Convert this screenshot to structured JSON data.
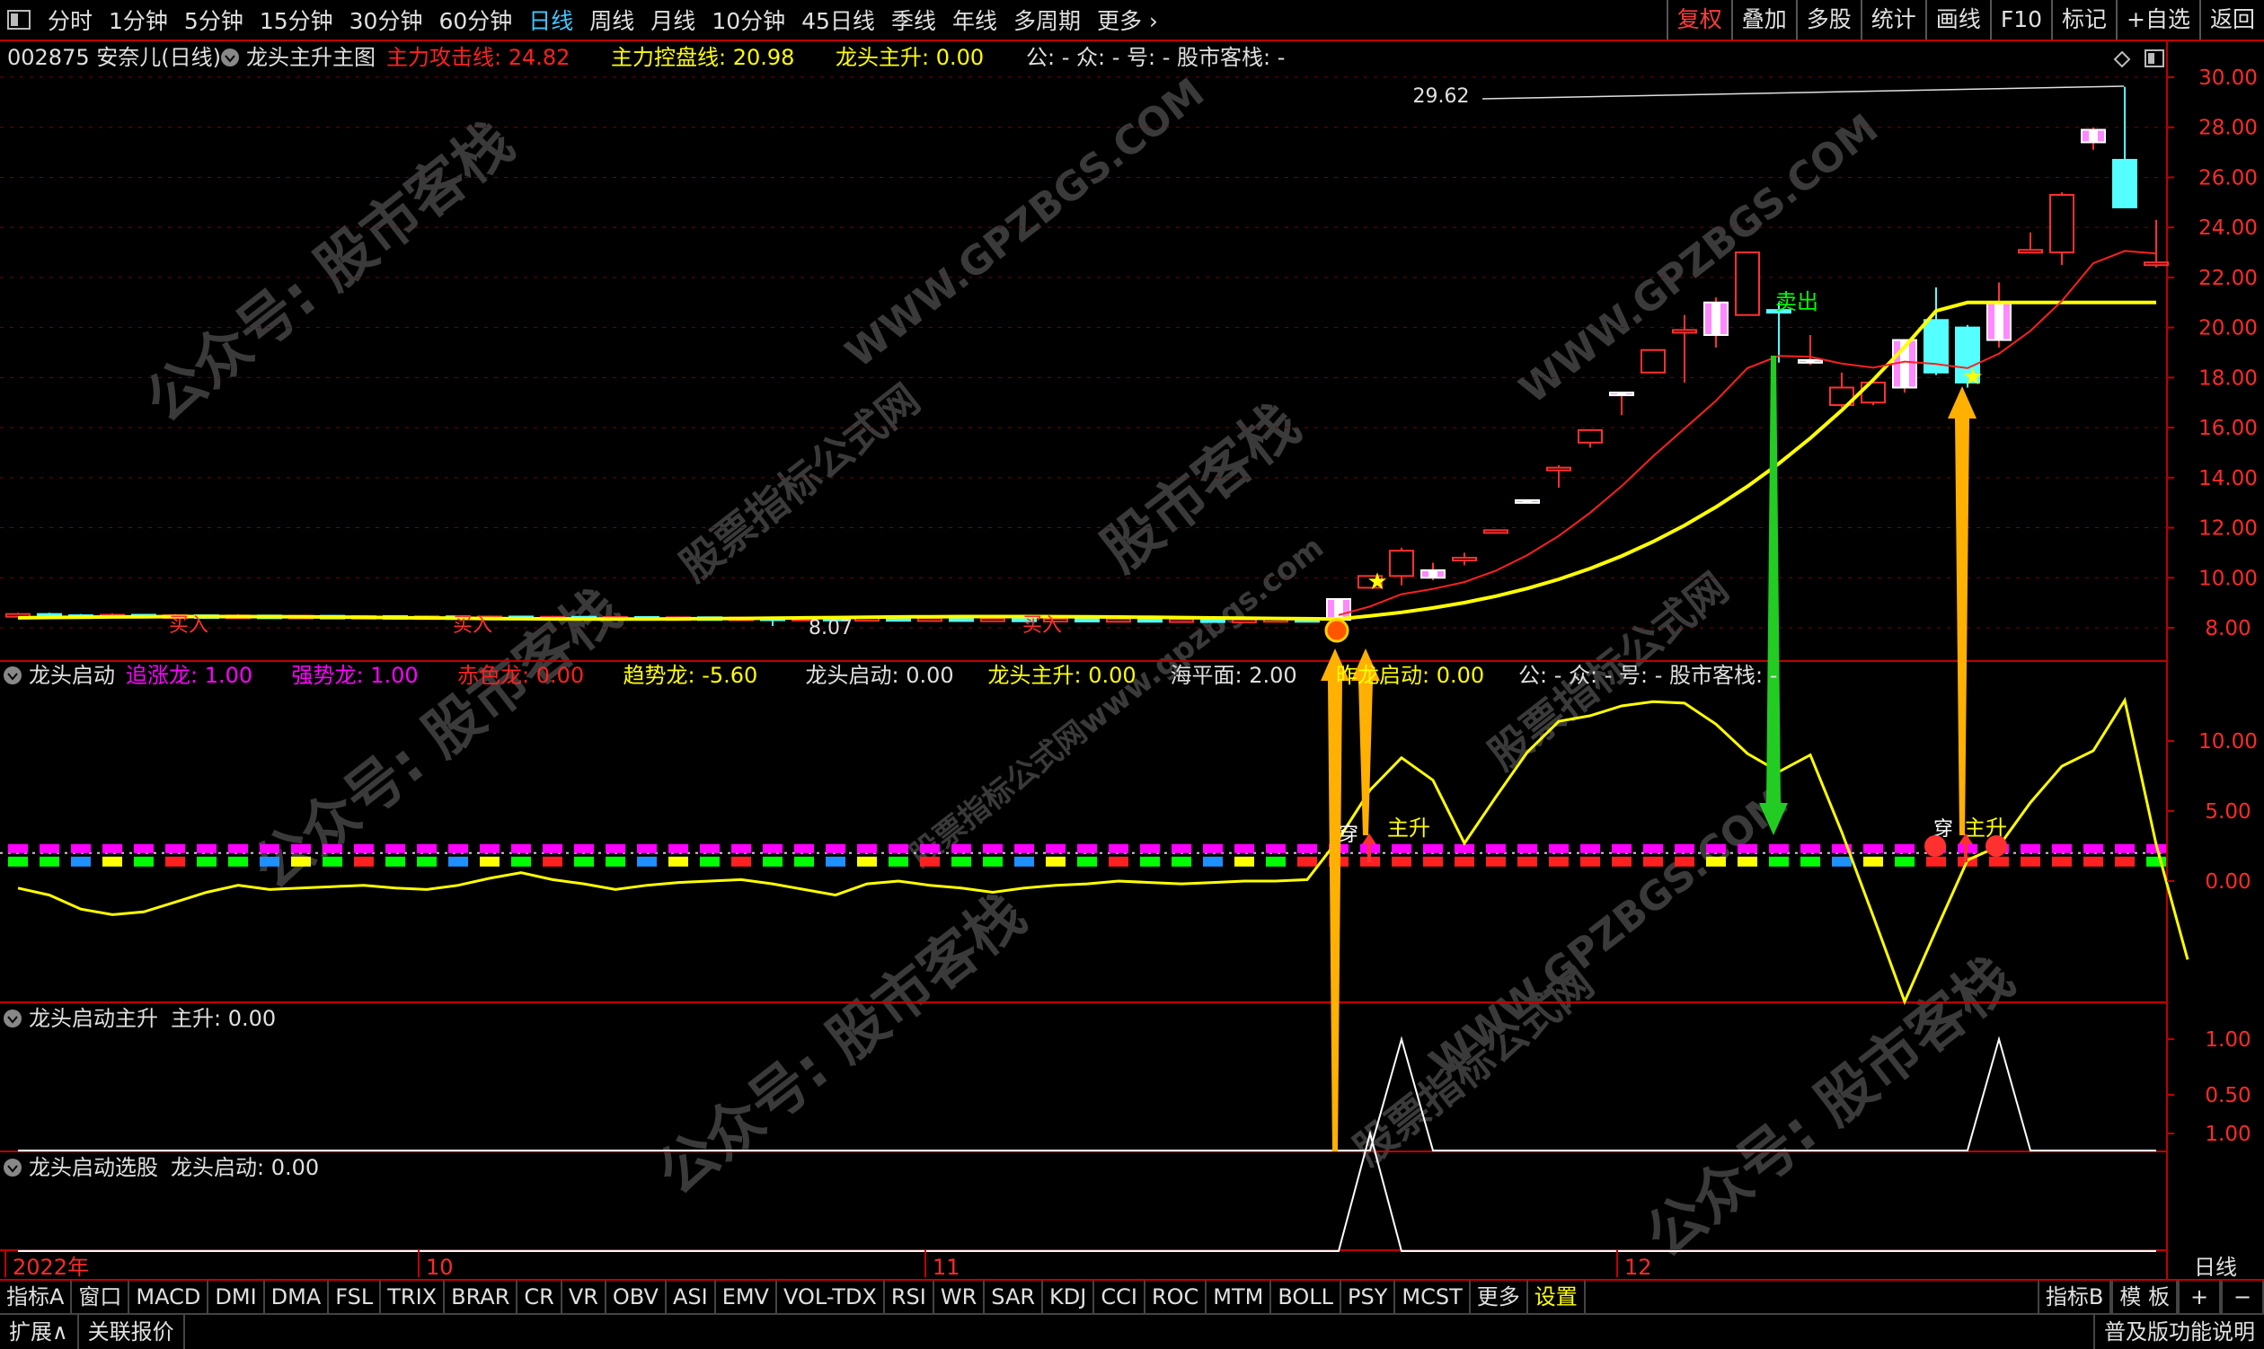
{
  "toolbar": {
    "periods": [
      "分时",
      "1分钟",
      "5分钟",
      "15分钟",
      "30分钟",
      "60分钟",
      "日线",
      "周线",
      "月线",
      "10分钟",
      "45日线",
      "季线",
      "年线",
      "多周期",
      "更多 ›"
    ],
    "active_period": "日线",
    "right_tabs": [
      "复权",
      "叠加",
      "多股",
      "统计",
      "画线",
      "F10",
      "标记",
      "+自选",
      "返回"
    ],
    "active_right_tab": "复权"
  },
  "main_panel": {
    "stock": "002875 安奈儿(日线)",
    "indicator": "龙头主升主图",
    "items": [
      {
        "label": "主力攻击线: 24.82",
        "color": "#ff2020"
      },
      {
        "label": "主力控盘线: 20.98",
        "color": "#ffff00"
      },
      {
        "label": "龙头主升: 0.00",
        "color": "#ffff00"
      },
      {
        "label": "公: -  众: -  号: -  股市客栈: -",
        "color": "#e0e0e0"
      }
    ],
    "y_ticks": [
      "30.00",
      "28.00",
      "26.00",
      "24.00",
      "22.00",
      "20.00",
      "18.00",
      "16.00",
      "14.00",
      "12.00",
      "10.00",
      "8.00"
    ],
    "annotations": {
      "high": "29.62",
      "low": "8.07",
      "sell": "卖出",
      "buy": "买入"
    }
  },
  "panel2": {
    "name": "龙头启动",
    "items": [
      {
        "label": "追涨龙: 1.00",
        "color": "#ff00ff"
      },
      {
        "label": "强势龙: 1.00",
        "color": "#ff00ff"
      },
      {
        "label": "赤色龙: 0.00",
        "color": "#ff2020"
      },
      {
        "label": "趋势龙: -5.60",
        "color": "#ffff00"
      },
      {
        "label": "龙头启动: 0.00",
        "color": "#e0e0e0"
      },
      {
        "label": "龙头主升: 0.00",
        "color": "#ffff00"
      },
      {
        "label": "海平面: 2.00",
        "color": "#e0e0e0"
      },
      {
        "label": "昨龙启动: 0.00",
        "color": "#ffff00"
      },
      {
        "label": "公: -  众: -  号: -  股市客栈: -",
        "color": "#e0e0e0"
      }
    ],
    "y_ticks": [
      "10.00",
      "5.00",
      "0.00"
    ],
    "tags": [
      "主升",
      "穿",
      "主升",
      "穿"
    ]
  },
  "panel3": {
    "name": "龙头启动主升",
    "value": "主升: 0.00",
    "y_ticks": [
      "1.00",
      "0.50"
    ]
  },
  "panel4": {
    "name": "龙头启动选股",
    "value": "龙头启动: 0.00",
    "y_ticks": [
      "1.00"
    ]
  },
  "x_axis": {
    "labels": [
      "2022年",
      "10",
      "11",
      "12"
    ],
    "right": "日线"
  },
  "bottom_tabs": [
    "指标A",
    "窗口",
    "MACD",
    "DMI",
    "DMA",
    "FSL",
    "TRIX",
    "BRAR",
    "CR",
    "VR",
    "OBV",
    "ASI",
    "EMV",
    "VOL-TDX",
    "RSI",
    "WR",
    "SAR",
    "KDJ",
    "CCI",
    "ROC",
    "MTM",
    "BOLL",
    "PSY",
    "MCST",
    "更多",
    "设置"
  ],
  "active_bottom_tab": "设置",
  "bottom_right": [
    "指标B",
    "模 板",
    "+",
    "−"
  ],
  "status": [
    "扩展∧",
    "关联报价",
    "普及版功能说明"
  ],
  "watermarks": [
    "公众号: 股市客栈",
    "WWW.GPZBGS.COM",
    "股票指标公式网",
    "股市客栈",
    "股票指标公式网www.gpzbgs.com"
  ],
  "candles": [
    {
      "o": 8.5,
      "c": 8.55,
      "h": 8.6,
      "l": 8.45
    },
    {
      "o": 8.55,
      "c": 8.5,
      "h": 8.6,
      "l": 8.45
    },
    {
      "o": 8.5,
      "c": 8.48,
      "h": 8.55,
      "l": 8.42
    },
    {
      "o": 8.48,
      "c": 8.52,
      "h": 8.58,
      "l": 8.44
    },
    {
      "o": 8.52,
      "c": 8.47,
      "h": 8.55,
      "l": 8.42
    },
    {
      "o": 8.47,
      "c": 8.5,
      "h": 8.55,
      "l": 8.43
    },
    {
      "o": 8.5,
      "c": 8.46,
      "h": 8.53,
      "l": 8.41
    },
    {
      "o": 8.46,
      "c": 8.49,
      "h": 8.54,
      "l": 8.42
    },
    {
      "o": 8.49,
      "c": 8.45,
      "h": 8.52,
      "l": 8.4
    },
    {
      "o": 8.45,
      "c": 8.48,
      "h": 8.52,
      "l": 8.41
    },
    {
      "o": 8.48,
      "c": 8.44,
      "h": 8.5,
      "l": 8.4
    },
    {
      "o": 8.44,
      "c": 8.47,
      "h": 8.5,
      "l": 8.4
    },
    {
      "o": 8.47,
      "c": 8.43,
      "h": 8.5,
      "l": 8.39
    },
    {
      "o": 8.43,
      "c": 8.46,
      "h": 8.5,
      "l": 8.4
    },
    {
      "o": 8.46,
      "c": 8.42,
      "h": 8.48,
      "l": 8.38
    },
    {
      "o": 8.42,
      "c": 8.45,
      "h": 8.49,
      "l": 8.39
    },
    {
      "o": 8.45,
      "c": 8.41,
      "h": 8.48,
      "l": 8.38
    },
    {
      "o": 8.41,
      "c": 8.44,
      "h": 8.48,
      "l": 8.38
    },
    {
      "o": 8.44,
      "c": 8.4,
      "h": 8.46,
      "l": 8.36
    },
    {
      "o": 8.4,
      "c": 8.43,
      "h": 8.47,
      "l": 8.37
    },
    {
      "o": 8.43,
      "c": 8.39,
      "h": 8.45,
      "l": 8.35
    },
    {
      "o": 8.39,
      "c": 8.42,
      "h": 8.46,
      "l": 8.36
    },
    {
      "o": 8.42,
      "c": 8.38,
      "h": 8.44,
      "l": 8.34
    },
    {
      "o": 8.38,
      "c": 8.41,
      "h": 8.45,
      "l": 8.35
    },
    {
      "o": 8.41,
      "c": 8.37,
      "h": 8.43,
      "l": 8.07
    },
    {
      "o": 8.37,
      "c": 8.4,
      "h": 8.44,
      "l": 8.34
    },
    {
      "o": 8.4,
      "c": 8.36,
      "h": 8.42,
      "l": 8.32
    },
    {
      "o": 8.36,
      "c": 8.39,
      "h": 8.43,
      "l": 8.33
    },
    {
      "o": 8.39,
      "c": 8.35,
      "h": 8.41,
      "l": 8.31
    },
    {
      "o": 8.35,
      "c": 8.38,
      "h": 8.42,
      "l": 8.32
    },
    {
      "o": 8.38,
      "c": 8.34,
      "h": 8.4,
      "l": 8.3
    },
    {
      "o": 8.34,
      "c": 8.37,
      "h": 8.41,
      "l": 8.31
    },
    {
      "o": 8.37,
      "c": 8.33,
      "h": 8.39,
      "l": 8.29
    },
    {
      "o": 8.33,
      "c": 8.36,
      "h": 8.4,
      "l": 8.3
    },
    {
      "o": 8.36,
      "c": 8.32,
      "h": 8.38,
      "l": 8.28
    },
    {
      "o": 8.32,
      "c": 8.35,
      "h": 8.39,
      "l": 8.29
    },
    {
      "o": 8.35,
      "c": 8.31,
      "h": 8.37,
      "l": 8.27
    },
    {
      "o": 8.31,
      "c": 8.34,
      "h": 8.38,
      "l": 8.28
    },
    {
      "o": 8.34,
      "c": 8.3,
      "h": 8.36,
      "l": 8.26
    },
    {
      "o": 8.3,
      "c": 8.33,
      "h": 8.37,
      "l": 8.27
    },
    {
      "o": 8.33,
      "c": 8.35,
      "h": 8.38,
      "l": 8.29
    },
    {
      "o": 8.35,
      "c": 8.32,
      "h": 8.38,
      "l": 8.28
    },
    {
      "o": 8.32,
      "c": 9.15,
      "h": 9.15,
      "l": 8.32
    },
    {
      "o": 9.6,
      "c": 10.07,
      "h": 10.07,
      "l": 9.6
    },
    {
      "o": 10.07,
      "c": 11.08,
      "h": 11.2,
      "l": 9.7
    },
    {
      "o": 10.0,
      "c": 10.3,
      "h": 10.6,
      "l": 9.9
    },
    {
      "o": 10.7,
      "c": 10.8,
      "h": 11.0,
      "l": 10.5
    },
    {
      "o": 11.8,
      "c": 11.9,
      "h": 11.9,
      "l": 11.8
    },
    {
      "o": 13.0,
      "c": 13.1,
      "h": 13.1,
      "l": 13.0
    },
    {
      "o": 14.3,
      "c": 14.4,
      "h": 14.5,
      "l": 13.6
    },
    {
      "o": 15.4,
      "c": 15.9,
      "h": 15.9,
      "l": 15.2
    },
    {
      "o": 17.3,
      "c": 17.4,
      "h": 17.4,
      "l": 16.5
    },
    {
      "o": 18.2,
      "c": 19.1,
      "h": 19.1,
      "l": 18.2
    },
    {
      "o": 19.8,
      "c": 19.9,
      "h": 20.5,
      "l": 17.8
    },
    {
      "o": 19.7,
      "c": 21.0,
      "h": 21.2,
      "l": 19.2
    },
    {
      "o": 20.5,
      "c": 23.0,
      "h": 23.0,
      "l": 20.5
    },
    {
      "o": 20.7,
      "c": 20.6,
      "h": 21.0,
      "l": 18.6
    },
    {
      "o": 18.6,
      "c": 18.7,
      "h": 19.7,
      "l": 18.5
    },
    {
      "o": 16.9,
      "c": 17.6,
      "h": 18.2,
      "l": 16.8
    },
    {
      "o": 17.0,
      "c": 17.8,
      "h": 17.9,
      "l": 16.9
    },
    {
      "o": 17.6,
      "c": 19.5,
      "h": 19.5,
      "l": 17.4
    },
    {
      "o": 20.3,
      "c": 18.2,
      "h": 21.6,
      "l": 18.1
    },
    {
      "o": 20.0,
      "c": 17.8,
      "h": 20.1,
      "l": 17.6
    },
    {
      "o": 19.5,
      "c": 21.0,
      "h": 21.8,
      "l": 19.2
    },
    {
      "o": 23.0,
      "c": 23.1,
      "h": 23.8,
      "l": 23.0
    },
    {
      "o": 23.0,
      "c": 25.3,
      "h": 25.4,
      "l": 22.5
    },
    {
      "o": 27.4,
      "c": 27.9,
      "h": 28.0,
      "l": 27.1
    },
    {
      "o": 26.7,
      "c": 24.8,
      "h": 29.62,
      "l": 24.8
    },
    {
      "o": 22.6,
      "c": 22.6,
      "h": 24.3,
      "l": 22.4
    }
  ]
}
